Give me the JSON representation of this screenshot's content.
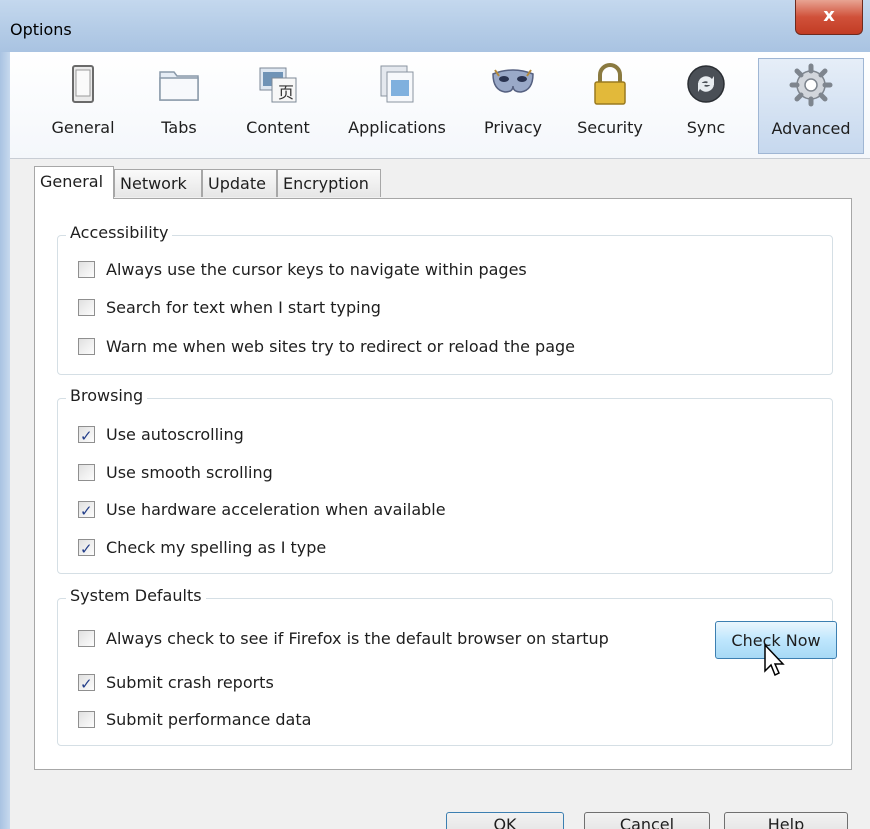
{
  "window": {
    "title": "Options",
    "close_label": "x"
  },
  "toolbar": {
    "items": [
      {
        "label": "General",
        "icon": "general-icon"
      },
      {
        "label": "Tabs",
        "icon": "tabs-icon"
      },
      {
        "label": "Content",
        "icon": "content-icon"
      },
      {
        "label": "Applications",
        "icon": "applications-icon"
      },
      {
        "label": "Privacy",
        "icon": "privacy-mask-icon"
      },
      {
        "label": "Security",
        "icon": "padlock-icon"
      },
      {
        "label": "Sync",
        "icon": "sync-icon"
      },
      {
        "label": "Advanced",
        "icon": "gear-icon",
        "selected": true
      }
    ]
  },
  "tabs": [
    {
      "label": "General",
      "active": true
    },
    {
      "label": "Network"
    },
    {
      "label": "Update"
    },
    {
      "label": "Encryption"
    }
  ],
  "accessibility": {
    "title": "Accessibility",
    "items": [
      {
        "label": "Always use the cursor keys to navigate within pages",
        "checked": false
      },
      {
        "label": "Search for text when I start typing",
        "checked": false
      },
      {
        "label": "Warn me when web sites try to redirect or reload the page",
        "checked": false
      }
    ]
  },
  "browsing": {
    "title": "Browsing",
    "items": [
      {
        "label": "Use autoscrolling",
        "checked": true
      },
      {
        "label": "Use smooth scrolling",
        "checked": false
      },
      {
        "label": "Use hardware acceleration when available",
        "checked": true
      },
      {
        "label": "Check my spelling as I type",
        "checked": true
      }
    ]
  },
  "system_defaults": {
    "title": "System Defaults",
    "items": [
      {
        "label": "Always check to see if Firefox is the default browser on startup",
        "checked": false
      },
      {
        "label": "Submit crash reports",
        "checked": true
      },
      {
        "label": "Submit performance data",
        "checked": false
      }
    ],
    "check_now_label": "Check Now"
  },
  "buttons": {
    "ok": "OK",
    "cancel": "Cancel",
    "help": "Help"
  },
  "colors": {
    "accent": "#3c7fb1",
    "close": "#c23c24",
    "check": "#243f8a"
  }
}
